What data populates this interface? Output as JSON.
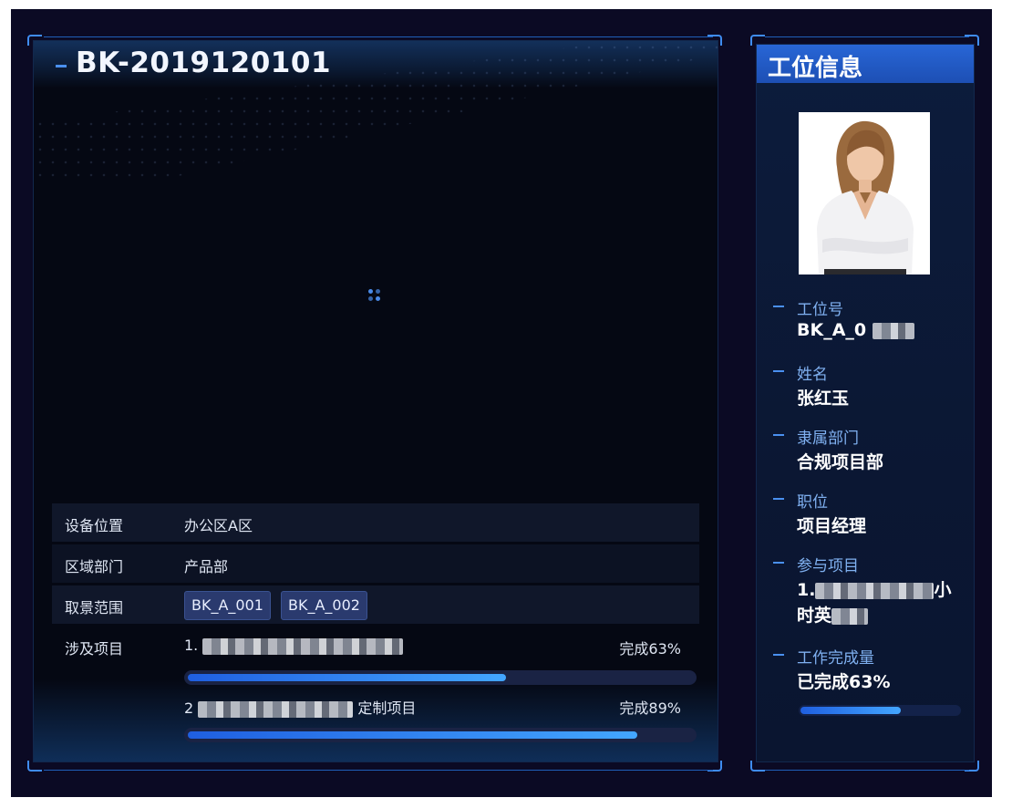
{
  "device": {
    "title": "BK-2019120101"
  },
  "info_table": {
    "location_label": "设备位置",
    "location_value": "办公区A区",
    "department_label": "区域部门",
    "department_value": "产品部",
    "view_range_label": "取景范围",
    "view_range_tags": [
      "BK_A_001",
      "BK_A_002"
    ],
    "projects_label": "涉及项目",
    "projects": [
      {
        "name_prefix": "1.",
        "status": "完成63%",
        "progress": 63
      },
      {
        "name_prefix": "2",
        "name_suffix": "定制项目",
        "status": "完成89%",
        "progress": 89
      }
    ]
  },
  "station_panel": {
    "title": "工位信息",
    "fields": {
      "station_no_label": "工位号",
      "station_no_value": "BK_A_0",
      "name_label": "姓名",
      "name_value": "张红玉",
      "dept_label": "隶属部门",
      "dept_value": "合规项目部",
      "position_label": "职位",
      "position_value": "项目经理",
      "projects_label": "参与项目",
      "projects_value_line1": "1.",
      "projects_value_line1_end": "小",
      "projects_value_line2": "时英",
      "workload_label": "工作完成量",
      "workload_value": "已完成63%",
      "workload_progress": 63
    }
  },
  "colors": {
    "accent": "#3f8cf0",
    "header_blue": "#2866d6",
    "background": "#0b0a24"
  }
}
